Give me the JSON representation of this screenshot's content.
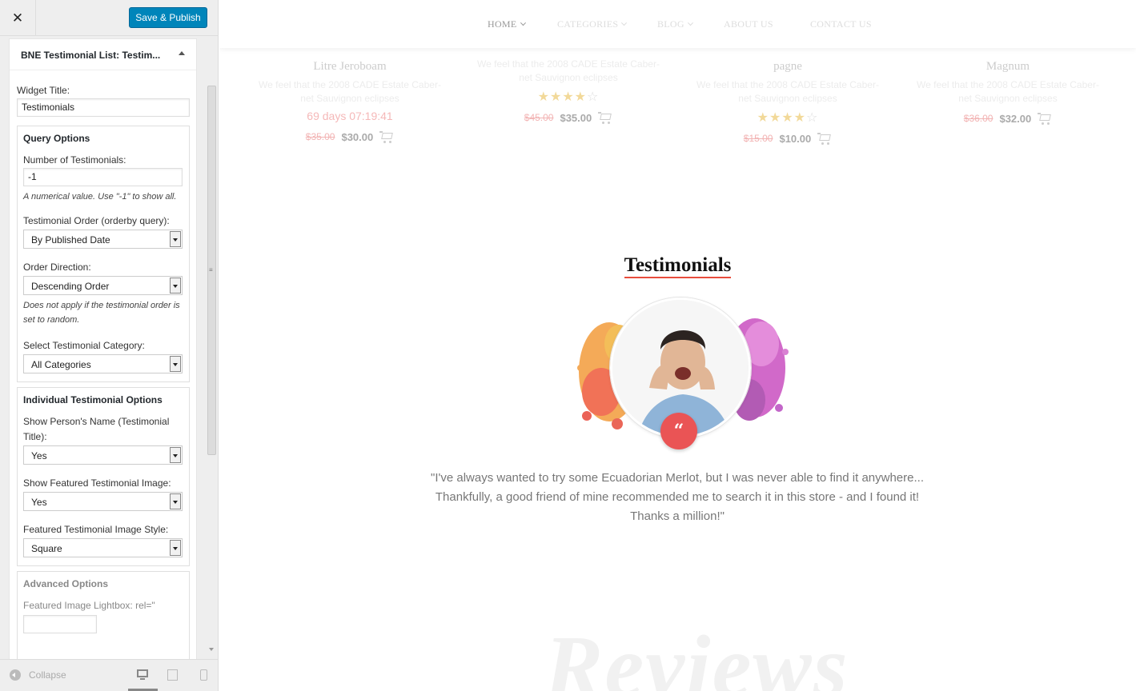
{
  "toolbar": {
    "close_label": "✕",
    "save_label": "Save & Publish"
  },
  "widget": {
    "header": "BNE Testimonial List: Testim...",
    "title_label": "Widget Title:",
    "title_value": "Testimonials",
    "query": {
      "heading": "Query Options",
      "count_label": "Number of Testimonials:",
      "count_value": "-1",
      "count_help": "A numerical value. Use \"-1\" to show all.",
      "order_label": "Testimonial Order (orderby query):",
      "order_value": "By Published Date",
      "direction_label": "Order Direction:",
      "direction_value": "Descending Order",
      "direction_help": "Does not apply if the testimonial order is set to random.",
      "category_label": "Select Testimonial Category:",
      "category_value": "All Categories"
    },
    "individual": {
      "heading": "Individual Testimonial Options",
      "name_label": "Show Person's Name (Testimonial Title):",
      "name_value": "Yes",
      "image_label": "Show Featured Testimonial Image:",
      "image_value": "Yes",
      "style_label": "Featured Testimonial Image Style:",
      "style_value": "Square"
    },
    "advanced": {
      "heading": "Advanced Options",
      "lightbox_label": "Featured Image Lightbox: rel=\""
    }
  },
  "footer": {
    "collapse_label": "Collapse"
  },
  "nav": {
    "home": "HOME",
    "categories": "CATEGORIES",
    "blog": "BLOG",
    "about": "ABOUT US",
    "contact": "CONTACT US"
  },
  "products": [
    {
      "name": "Litre Jeroboam",
      "desc": "We feel that the 2008 CADE Estate Caber-net Sauvignon eclipses",
      "timer": "69 days 07:19:41",
      "old": "$35.00",
      "new": "$30.00",
      "rating": 0
    },
    {
      "name": "",
      "desc": "We feel that the 2008 CADE Estate Caber-net Sauvignon eclipses",
      "timer": "",
      "old": "$45.00",
      "new": "$35.00",
      "rating": 4
    },
    {
      "name": "pagne",
      "desc": "We feel that the 2008 CADE Estate Caber-net Sauvignon eclipses",
      "timer": "",
      "old": "$15.00",
      "new": "$10.00",
      "rating": 4
    },
    {
      "name": "Magnum",
      "desc": "We feel that the 2008 CADE Estate Caber-net Sauvignon eclipses",
      "timer": "",
      "old": "$36.00",
      "new": "$32.00",
      "rating": 0
    }
  ],
  "testimonials": {
    "title": "Testimonials",
    "quote_icon": "“",
    "quote": "\"I've always wanted to try some Ecuadorian Merlot, but I was never able to find it anywhere... Thankfully, a good friend of mine recommended me to search it in this store - and I found it! Thanks a million!\""
  },
  "watermark": "Reviews",
  "colors": {
    "accent": "#0085ba",
    "brand_red": "#ea5455"
  }
}
